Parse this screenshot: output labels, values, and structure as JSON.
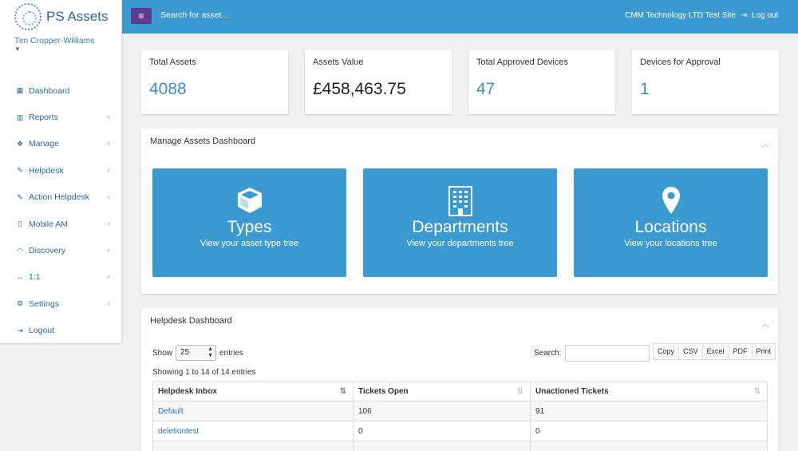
{
  "brand": {
    "name": "PS Assets"
  },
  "user": {
    "name": "Tim Cropper-Williams"
  },
  "sidebar": {
    "items": [
      {
        "label": "Dashboard",
        "icon": "dashboard-icon",
        "glyph": "▦",
        "arrow": ""
      },
      {
        "label": "Reports",
        "icon": "bar-chart-icon",
        "glyph": "▥",
        "arrow": "‹"
      },
      {
        "label": "Manage",
        "icon": "cubes-icon",
        "glyph": "❖",
        "arrow": "‹"
      },
      {
        "label": "Helpdesk",
        "icon": "wrench-icon",
        "glyph": "✎",
        "arrow": "‹"
      },
      {
        "label": "Action Helpdesk",
        "icon": "wrench-icon",
        "glyph": "✎",
        "arrow": "‹"
      },
      {
        "label": "Mobile AM",
        "icon": "mobile-icon",
        "glyph": "▯",
        "arrow": "‹"
      },
      {
        "label": "Discovery",
        "icon": "wifi-icon",
        "glyph": "◠",
        "arrow": "‹"
      },
      {
        "label": "1:1",
        "icon": "arrows-h-icon",
        "glyph": "↔",
        "arrow": "‹"
      },
      {
        "label": "Settings",
        "icon": "cogs-icon",
        "glyph": "⚙",
        "arrow": "‹"
      },
      {
        "label": "Logout",
        "icon": "sign-out-icon",
        "glyph": "⇥",
        "arrow": ""
      }
    ]
  },
  "topbar": {
    "menu_glyph": "≡",
    "search_placeholder": "Search for asset...",
    "site_name": "CMM Technology LTD Test Site",
    "logout_label": "Log out"
  },
  "stats": [
    {
      "title": "Total Assets",
      "value": "4088"
    },
    {
      "title": "Assets Value",
      "value": "£458,463.75"
    },
    {
      "title": "Total Approved Devices",
      "value": "47"
    },
    {
      "title": "Devices for Approval",
      "value": "1"
    }
  ],
  "manage_panel": {
    "title": "Manage Assets Dashboard",
    "tiles": [
      {
        "title": "Types",
        "subtitle": "View your asset type tree",
        "icon": "cube-icon"
      },
      {
        "title": "Departments",
        "subtitle": "View your departments tree",
        "icon": "building-icon"
      },
      {
        "title": "Locations",
        "subtitle": "View your locations tree",
        "icon": "map-marker-icon"
      }
    ]
  },
  "helpdesk_panel": {
    "title": "Helpdesk Dashboard",
    "show_label": "Show",
    "entries_value": "25",
    "entries_label": "entries",
    "search_label": "Search:",
    "buttons": [
      "Copy",
      "CSV",
      "Excel",
      "PDF",
      "Print"
    ],
    "info": "Showing 1 to 14 of 14 entries",
    "columns": [
      "Helpdesk Inbox",
      "Tickets Open",
      "Unactioned Tickets"
    ],
    "rows": [
      [
        "Default",
        "106",
        "91"
      ],
      [
        "deletiontest",
        "0",
        "0"
      ]
    ]
  },
  "colors": {
    "primary": "#3c9ad3",
    "menu_button": "#5e3d91",
    "link": "#2a7ab8"
  }
}
